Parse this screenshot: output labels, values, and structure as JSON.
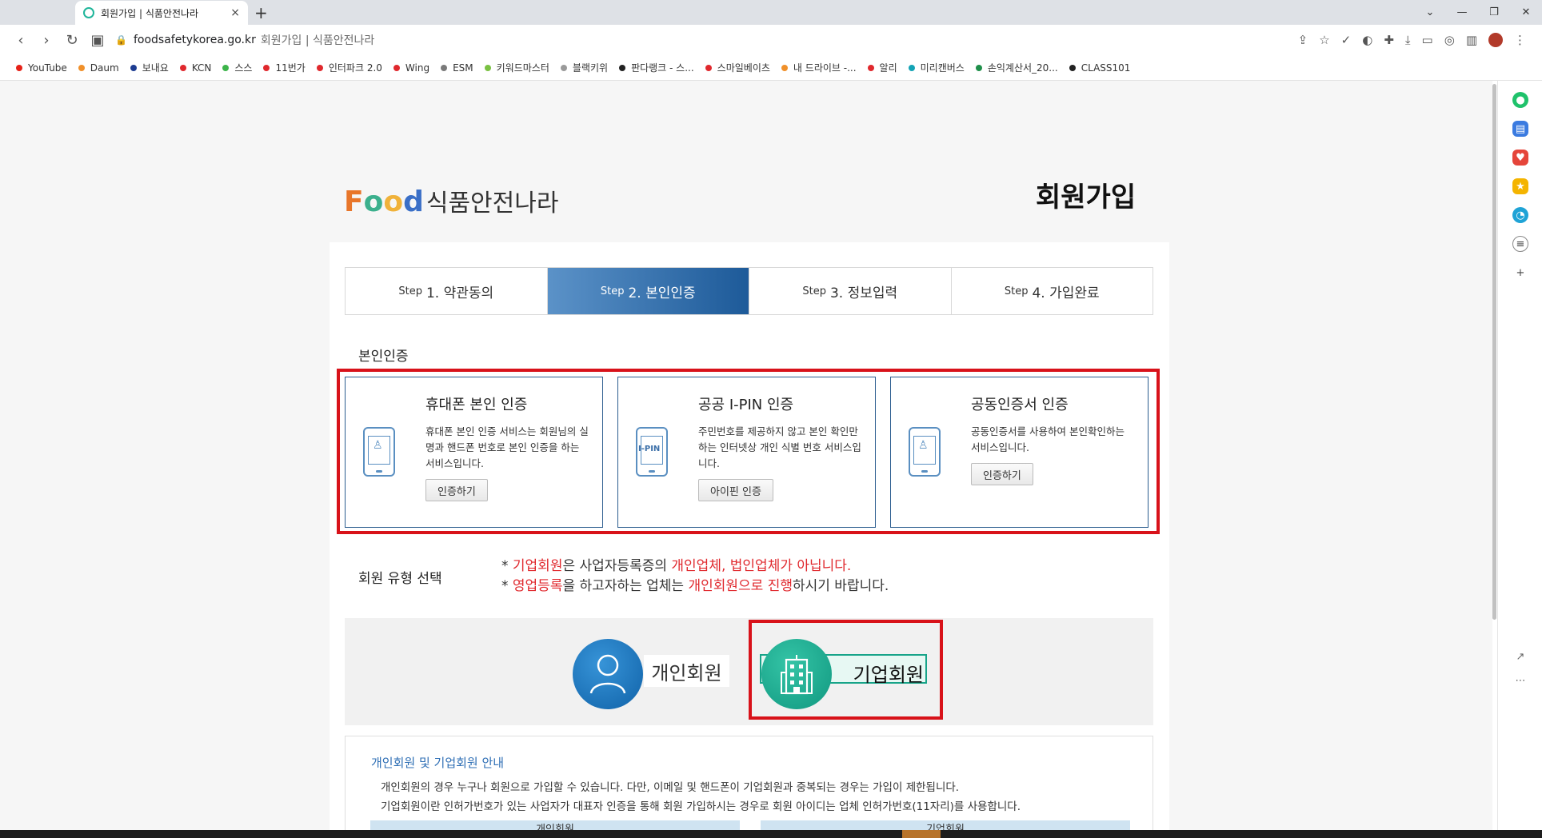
{
  "browser": {
    "tab_title": "회원가입 | 식품안전나라",
    "tab_close": "×",
    "new_tab": "+",
    "url_domain": "foodsafetykorea.go.kr",
    "url_title": "회원가입 | 식품안전나라",
    "bookmarks": [
      {
        "label": "YouTube",
        "color": "#e62117"
      },
      {
        "label": "Daum",
        "color": "#f0902a"
      },
      {
        "label": "보내요",
        "color": "#1d3c91"
      },
      {
        "label": "KCN",
        "color": "#e0282d"
      },
      {
        "label": "스스",
        "color": "#3cb44a"
      },
      {
        "label": "11번가",
        "color": "#e0282d"
      },
      {
        "label": "인터파크 2.0",
        "color": "#e0282d"
      },
      {
        "label": "Wing",
        "color": "#e0282d"
      },
      {
        "label": "ESM",
        "color": "#7a7a7a"
      },
      {
        "label": "키워드마스터",
        "color": "#7ac142"
      },
      {
        "label": "블랙키위",
        "color": "#9a9a9a"
      },
      {
        "label": "판다랭크 - 스...",
        "color": "#222222"
      },
      {
        "label": "스마일베이츠",
        "color": "#e0282d"
      },
      {
        "label": "내 드라이브 -...",
        "color": "#f0902a"
      },
      {
        "label": "알리",
        "color": "#e0282d"
      },
      {
        "label": "미리캔버스",
        "color": "#13a3b5"
      },
      {
        "label": "손익계산서_20...",
        "color": "#1f8f4a"
      },
      {
        "label": "CLASS101",
        "color": "#222222"
      }
    ]
  },
  "header": {
    "logo_f": "F",
    "logo_o1": "o",
    "logo_o2": "o",
    "logo_d": "d",
    "logo_text": "식품안전나라",
    "page_title": "회원가입"
  },
  "steps": [
    {
      "prefix": "Step",
      "label": "1. 약관동의"
    },
    {
      "prefix": "Step",
      "label": "2. 본인인증"
    },
    {
      "prefix": "Step",
      "label": "3. 정보입력"
    },
    {
      "prefix": "Step",
      "label": "4. 가입완료"
    }
  ],
  "verification": {
    "section_label": "본인인증",
    "options": [
      {
        "title": "휴대폰 본인 인증",
        "desc": "휴대폰 본인 인증 서비스는 회원님의 실명과 핸드폰 번호로 본인 인증을 하는 서비스입니다.",
        "button": "인증하기"
      },
      {
        "title": "공공 I-PIN 인증",
        "desc": "주민번호를 제공하지 않고 본인 확인만 하는 인터넷상 개인 식별 번호 서비스입니다.",
        "button": "아이핀 인증",
        "icon_text": "I-PIN"
      },
      {
        "title": "공동인증서 인증",
        "desc": "공동인증서를 사용하여 본인확인하는 서비스입니다.",
        "button": "인증하기"
      }
    ]
  },
  "member_type": {
    "section_label": "회원 유형 선택",
    "notice1_prefix": "* ",
    "notice1_red1": "기업회원",
    "notice1_mid": "은 사업자등록증의 ",
    "notice1_red2": "개인업체, 법인업체가 아닙니다.",
    "notice2_prefix": "* ",
    "notice2_red1": "영업등록",
    "notice2_mid": "을 하고자하는 업체는 ",
    "notice2_red2": "개인회원으로 진행",
    "notice2_end": "하시기 바랍니다.",
    "personal_label": "개인회원",
    "corporate_label": "기업회원"
  },
  "info": {
    "title": "개인회원 및 기업회원 안내",
    "line1": "개인회원의 경우 누구나 회원으로 가입할 수 있습니다. 다만, 이메일 및 핸드폰이 기업회원과 중복되는 경우는 가입이 제한됩니다.",
    "line2": "기업회원이란 인허가번호가 있는 사업자가 대표자 인증을 통해 회원 가입하시는 경우로 회원 아이디는 업체 인허가번호(11자리)를 사용합니다.",
    "tab_personal": "개인회원",
    "tab_corporate": "기업회원"
  }
}
